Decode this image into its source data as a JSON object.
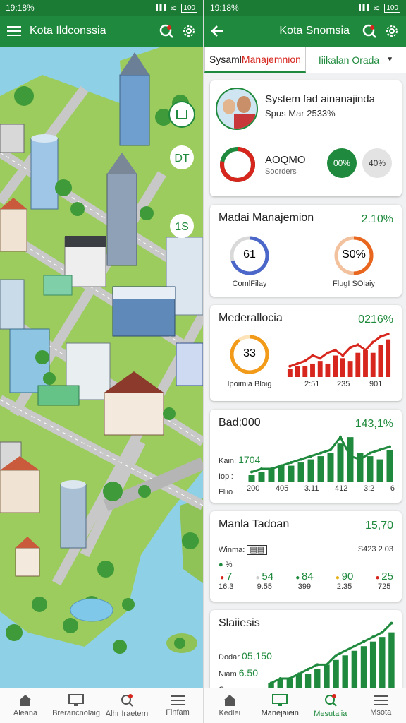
{
  "left": {
    "status": {
      "time": "19:18%",
      "battery": "100"
    },
    "appbar": {
      "title": "Kota Ildconssia"
    },
    "map_badges": [
      "DT",
      "1S"
    ],
    "nav": [
      "Aleana",
      "Brerancnolaig",
      "Alhr Iraetern",
      "Finfam"
    ]
  },
  "right": {
    "status": {
      "time": "19:18%",
      "battery": "100"
    },
    "appbar": {
      "title": "Kota Snomsia"
    },
    "tabs": {
      "tab1_a": "Sysaml ",
      "tab1_b": "Manajemnion",
      "tab2": "Iiikalan Orada"
    },
    "card1": {
      "title": "System fad ainanajinda",
      "subtitle": "Spus Mar 2533%",
      "metric_title": "AOQMO",
      "metric_sub": "Soorders",
      "pill1": "00%",
      "pill2": "40%",
      "ring_fraction": 0.78
    },
    "card2": {
      "title": "Madai Manajemion",
      "value": "2.10%",
      "ring1_value": "61",
      "ring1_label": "ComlFilay",
      "ring1_fraction": 0.7,
      "ring2_value": "S0%",
      "ring2_label": "FlugI SOlaiy",
      "ring2_fraction": 0.5
    },
    "card3": {
      "title": "Mederallocia",
      "value": "0216%",
      "ring_value": "33",
      "ring_label": "Ipoimia Bloig",
      "ring_fraction": 0.9,
      "x_labels": [
        "2:51",
        "235",
        "901"
      ]
    },
    "card4": {
      "title": "Bad;000",
      "value": "143,1%",
      "rows": [
        {
          "label": "Kain:",
          "value": "1704"
        },
        {
          "label": "Iopl:",
          "value": ""
        },
        {
          "label": "Fliio",
          "value": ""
        }
      ],
      "x_labels": [
        "200",
        "405",
        "3.11",
        "412",
        "3:2",
        "6"
      ]
    },
    "card5": {
      "title": "Manla Tadoan",
      "value": "15,70",
      "sub_label": "Winma:",
      "sub_value": "S423 2 03",
      "legend_top": "%",
      "stats": [
        {
          "value": "7",
          "sub": "16.3",
          "color": "#d7261d"
        },
        {
          "value": "54",
          "sub": "9.55",
          "color": "#cccccc"
        },
        {
          "value": "84",
          "sub": "399",
          "color": "#1f8a3d"
        },
        {
          "value": "90",
          "sub": "2.35",
          "color": "#e8b21c"
        },
        {
          "value": "25",
          "sub": "725",
          "color": "#d7261d"
        }
      ]
    },
    "card6": {
      "title": "Slaiiesis",
      "rows": [
        {
          "label": "Dodar",
          "value": "05,150"
        },
        {
          "label": "Niam",
          "value": "6.50"
        },
        {
          "label": "Cora",
          "value": ""
        }
      ]
    },
    "nav": [
      "Kedlei",
      "Manejaiein",
      "Mesutaiia",
      "Msota"
    ]
  },
  "chart_data": [
    {
      "type": "bar",
      "title": "Mederallocia",
      "categories": [
        "2:51",
        "",
        "235",
        "",
        "901",
        "",
        "",
        "",
        "",
        "",
        "",
        "",
        "",
        ""
      ],
      "values": [
        3,
        4,
        4,
        5,
        6,
        5,
        8,
        7,
        6,
        9,
        10,
        9,
        12,
        14
      ],
      "series_line": [
        4,
        5,
        6,
        8,
        7,
        9,
        10,
        8,
        11,
        12,
        10,
        13,
        15,
        16
      ],
      "color": "#d7261d"
    },
    {
      "type": "bar",
      "title": "Bad;000",
      "categories": [
        "200",
        "405",
        "3.11",
        "412",
        "3:2",
        "6"
      ],
      "values": [
        2,
        3,
        4,
        5,
        5,
        6,
        7,
        8,
        9,
        12,
        14,
        9,
        8,
        7,
        10
      ],
      "line": [
        3,
        4,
        4,
        5,
        6,
        7,
        8,
        9,
        10,
        14,
        8,
        7,
        9,
        10,
        11
      ],
      "color": "#1f8a3d"
    },
    {
      "type": "bar",
      "title": "Slaiiesis",
      "values": [
        1,
        2,
        2,
        3,
        3,
        4,
        5,
        6,
        7,
        8,
        9,
        10,
        11,
        12
      ],
      "line": [
        1,
        2,
        2,
        3,
        4,
        5,
        5,
        7,
        8,
        9,
        10,
        11,
        12,
        14
      ],
      "color": "#1f8a3d"
    }
  ]
}
